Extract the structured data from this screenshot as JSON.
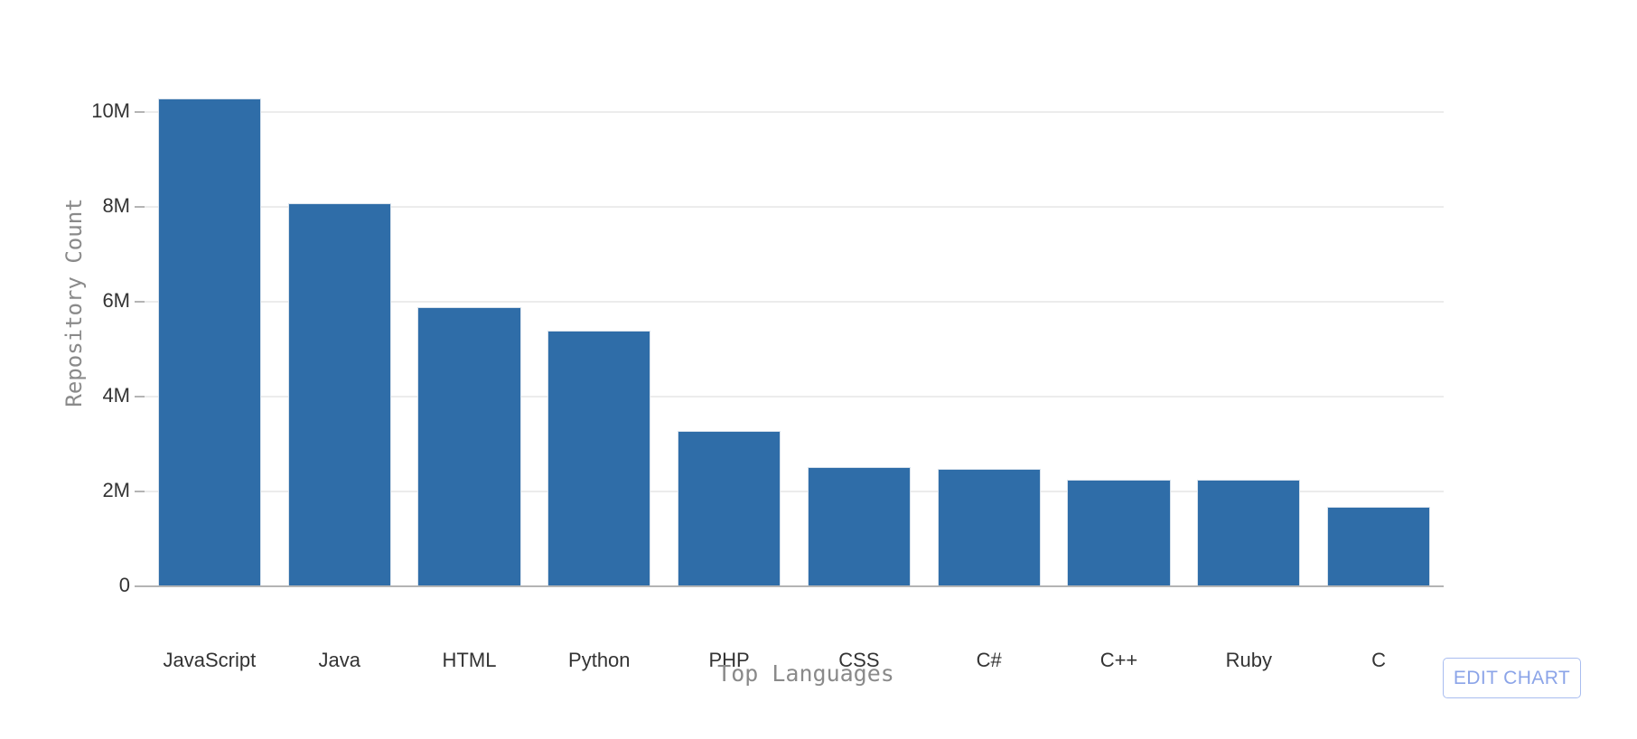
{
  "chart_data": {
    "type": "bar",
    "title": "",
    "xlabel": "Top Languages",
    "ylabel": "Repository Count",
    "categories": [
      "JavaScript",
      "Java",
      "HTML",
      "Python",
      "PHP",
      "CSS",
      "C#",
      "C++",
      "Ruby",
      "C"
    ],
    "values": [
      10270000,
      8050000,
      5860000,
      5370000,
      3250000,
      2500000,
      2450000,
      2230000,
      2230000,
      1650000
    ],
    "ylim": [
      0,
      11200000
    ],
    "ytick_values": [
      0,
      2000000,
      4000000,
      6000000,
      8000000,
      10000000
    ],
    "ytick_labels": [
      "0",
      "2M",
      "4M",
      "6M",
      "8M",
      "10M"
    ],
    "grid": true,
    "legend": false,
    "bar_color": "#2f6da8",
    "gridline_color": "#ececec",
    "axis_color": "#b4b4b4",
    "axis_title_color": "#8a8a8a",
    "tick_label_color": "#333333"
  },
  "controls": {
    "edit_chart_label": "EDIT CHART",
    "edit_chart_border_color": "#a9bdf0",
    "edit_chart_text_color": "#8ba4e8"
  }
}
